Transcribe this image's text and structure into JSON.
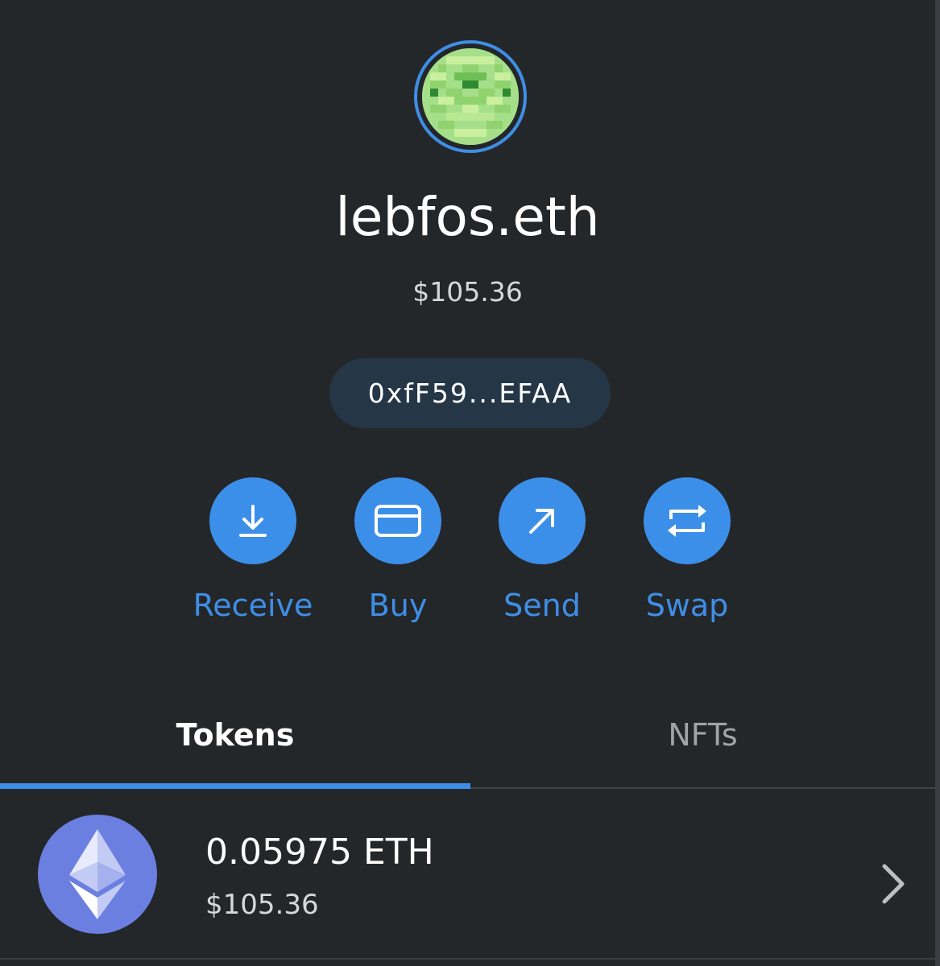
{
  "account": {
    "name": "lebfos.eth",
    "balance": "$105.36",
    "address": "0xfF59...EFAA"
  },
  "actions": [
    {
      "label": "Receive",
      "icon": "download-icon"
    },
    {
      "label": "Buy",
      "icon": "credit-card-icon"
    },
    {
      "label": "Send",
      "icon": "arrow-up-right-icon"
    },
    {
      "label": "Swap",
      "icon": "swap-arrows-icon"
    }
  ],
  "tabs": [
    {
      "label": "Tokens",
      "active": true
    },
    {
      "label": "NFTs",
      "active": false
    }
  ],
  "tokens": [
    {
      "amount": "0.05975 ETH",
      "fiat": "$105.36",
      "icon": "ethereum-icon"
    }
  ],
  "colors": {
    "background": "#24272a",
    "accent": "#3c8fe9",
    "address_pill": "#253646",
    "eth_logo": "#6b7fe0"
  }
}
